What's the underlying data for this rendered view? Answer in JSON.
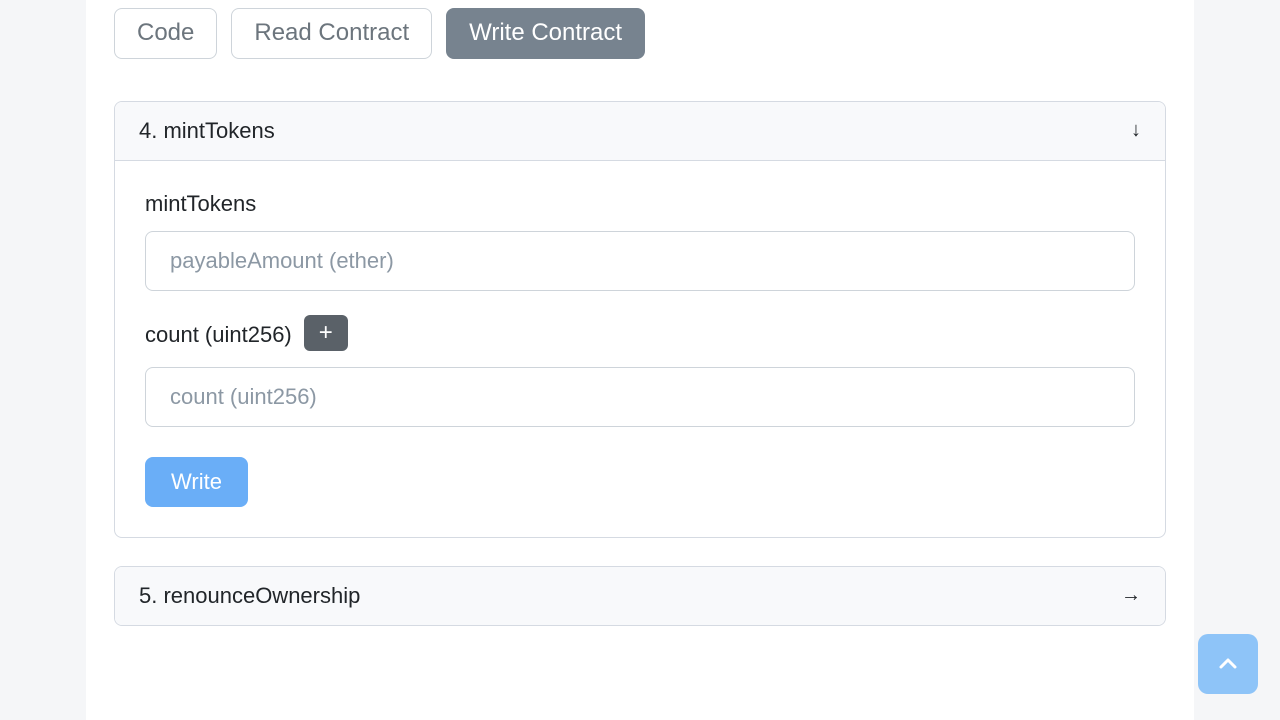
{
  "tabs": {
    "code": "Code",
    "read": "Read Contract",
    "write": "Write Contract"
  },
  "section4": {
    "header": "4. mintTokens",
    "fn_label": "mintTokens",
    "payable_placeholder": "payableAmount (ether)",
    "count_label": "count (uint256)",
    "count_placeholder": "count (uint256)",
    "write_label": "Write"
  },
  "section5": {
    "header": "5. renounceOwnership"
  }
}
